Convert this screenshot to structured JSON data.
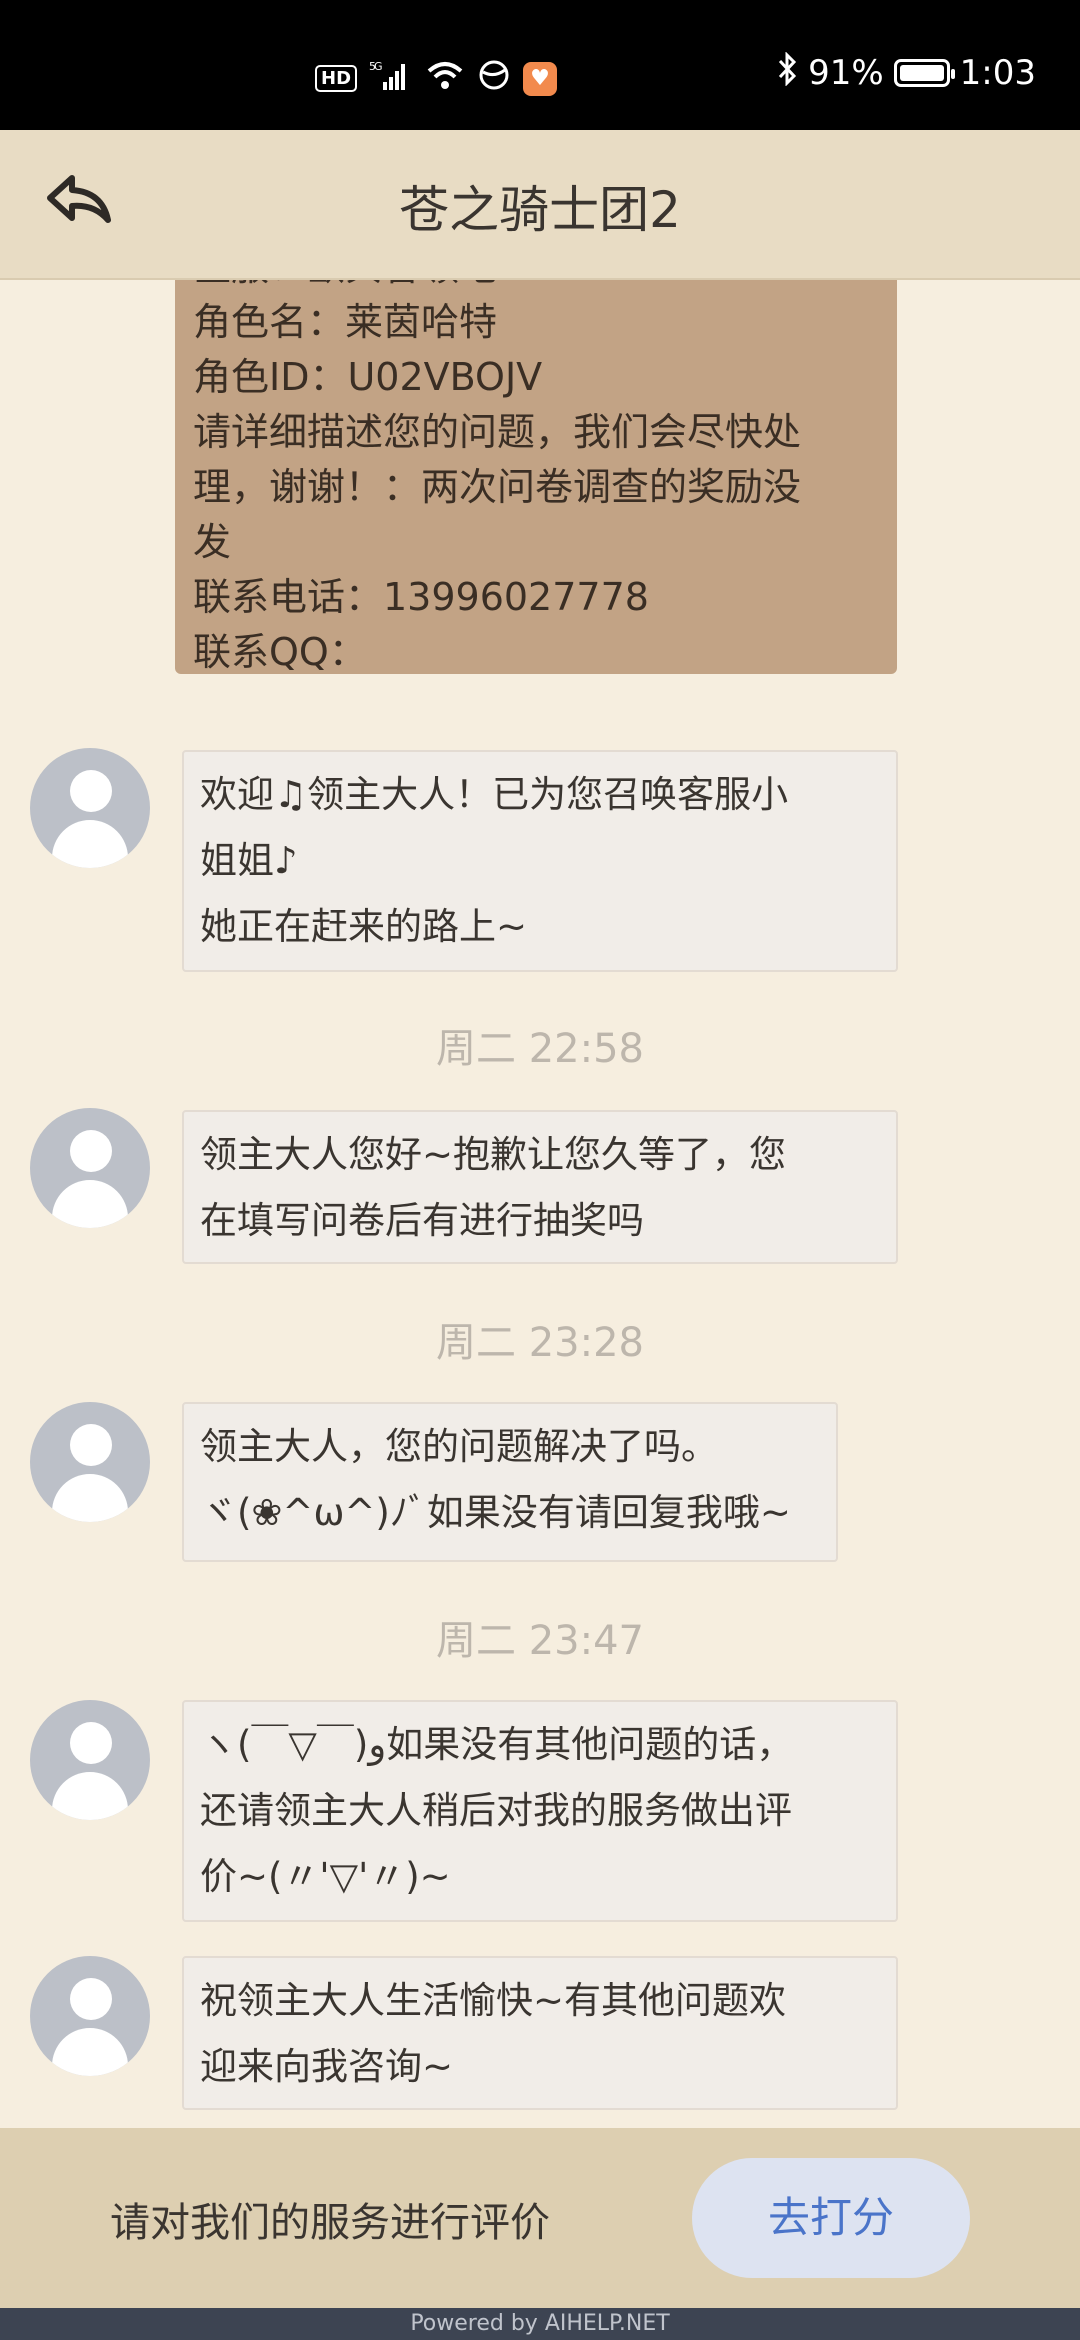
{
  "status_bar": {
    "hd": "HD",
    "network": "5G",
    "battery": "91%",
    "time": "1:03"
  },
  "header": {
    "title": "苍之骑士团2"
  },
  "user_message": {
    "lines": [
      "区服：欧贝鲁领地",
      "角色名：莱茵哈特",
      "角色ID：U02VBOJV",
      "请详细描述您的问题，我们会尽快处",
      "理，谢谢！：两次问卷调查的奖励没",
      "发",
      "联系电话：13996027778",
      "联系QQ："
    ]
  },
  "messages": [
    {
      "lines": [
        "欢迎♫领主大人！已为您召唤客服小",
        "姐姐♪",
        "她正在赶来的路上~"
      ]
    },
    {
      "timestamp": "周二 22:58",
      "lines": [
        "领主大人您好~抱歉让您久等了，您",
        "在填写问卷后有进行抽奖吗"
      ]
    },
    {
      "timestamp": "周二 23:28",
      "lines": [
        "领主大人，您的问题解决了吗。",
        "ヾ(❀^ω^)ﾉﾞ如果没有请回复我哦~"
      ]
    },
    {
      "timestamp": "周二 23:47",
      "lines": [
        "ヽ(￣▽￣)و如果没有其他问题的话，",
        "还请领主大人稍后对我的服务做出评",
        "价~(〃'▽'〃)~"
      ]
    },
    {
      "lines": [
        "祝领主大人生活愉快~有其他问题欢",
        "迎来向我咨询~"
      ]
    }
  ],
  "rating": {
    "prompt": "请对我们的服务进行评价",
    "button": "去打分"
  },
  "footer": "Powered by AIHELP.NET",
  "colors": {
    "background": "#f6eedf",
    "header": "#e8dcc4",
    "user_bubble": "#c2a385",
    "agent_bubble": "#f1ede8",
    "rating_button": "#dde3f1",
    "rating_button_text": "#4a74c9"
  }
}
